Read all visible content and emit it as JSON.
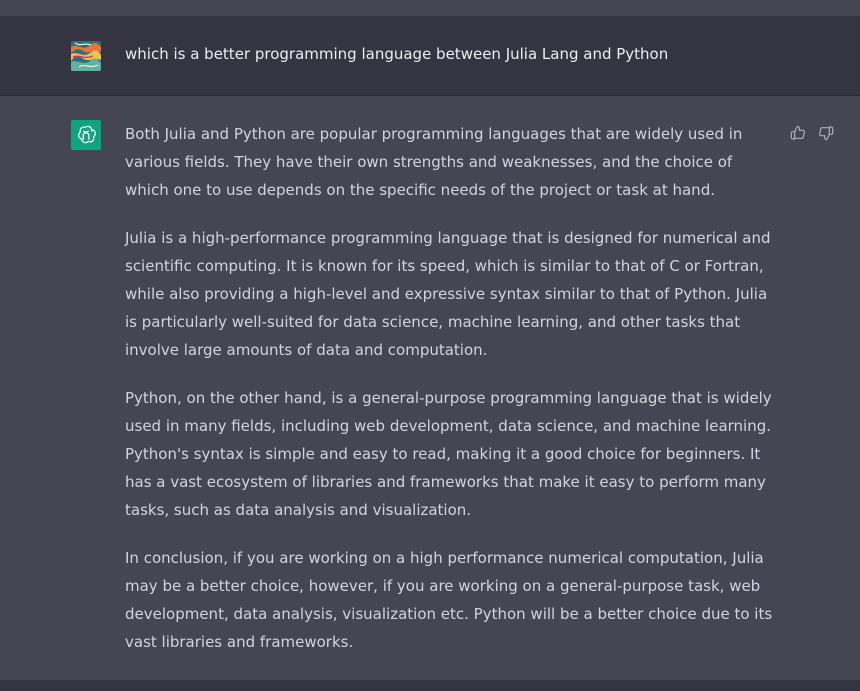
{
  "conversation": {
    "user_message": {
      "text": "which is a better programming language between Julia Lang and Python",
      "avatar_icon": "user-avatar-image"
    },
    "assistant_message": {
      "avatar_icon": "openai-logo-icon",
      "accent_color": "#10a37f",
      "paragraphs": [
        "Both Julia and Python are popular programming languages that are widely used in various fields. They have their own strengths and weaknesses, and the choice of which one to use depends on the specific needs of the project or task at hand.",
        "Julia is a high-performance programming language that is designed for numerical and scientific computing. It is known for its speed, which is similar to that of C or Fortran, while also providing a high-level and expressive syntax similar to that of Python. Julia is particularly well-suited for data science, machine learning, and other tasks that involve large amounts of data and computation.",
        "Python, on the other hand, is a general-purpose programming language that is widely used in many fields, including web development, data science, and machine learning. Python's syntax is simple and easy to read, making it a good choice for beginners. It has a vast ecosystem of libraries and frameworks that make it easy to perform many tasks, such as data analysis and visualization.",
        "In conclusion, if you are working on a high performance numerical computation, Julia may be a better choice, however, if you are working on a general-purpose task, web development, data analysis, visualization etc. Python will be a better choice due to its vast libraries and frameworks."
      ],
      "feedback": {
        "thumbs_up_icon": "thumbs-up-icon",
        "thumbs_down_icon": "thumbs-down-icon"
      }
    }
  },
  "colors": {
    "user_row_bg": "#343541",
    "assistant_row_bg": "#444654",
    "text_primary": "#ececf1",
    "text_secondary": "#d1d5db"
  }
}
